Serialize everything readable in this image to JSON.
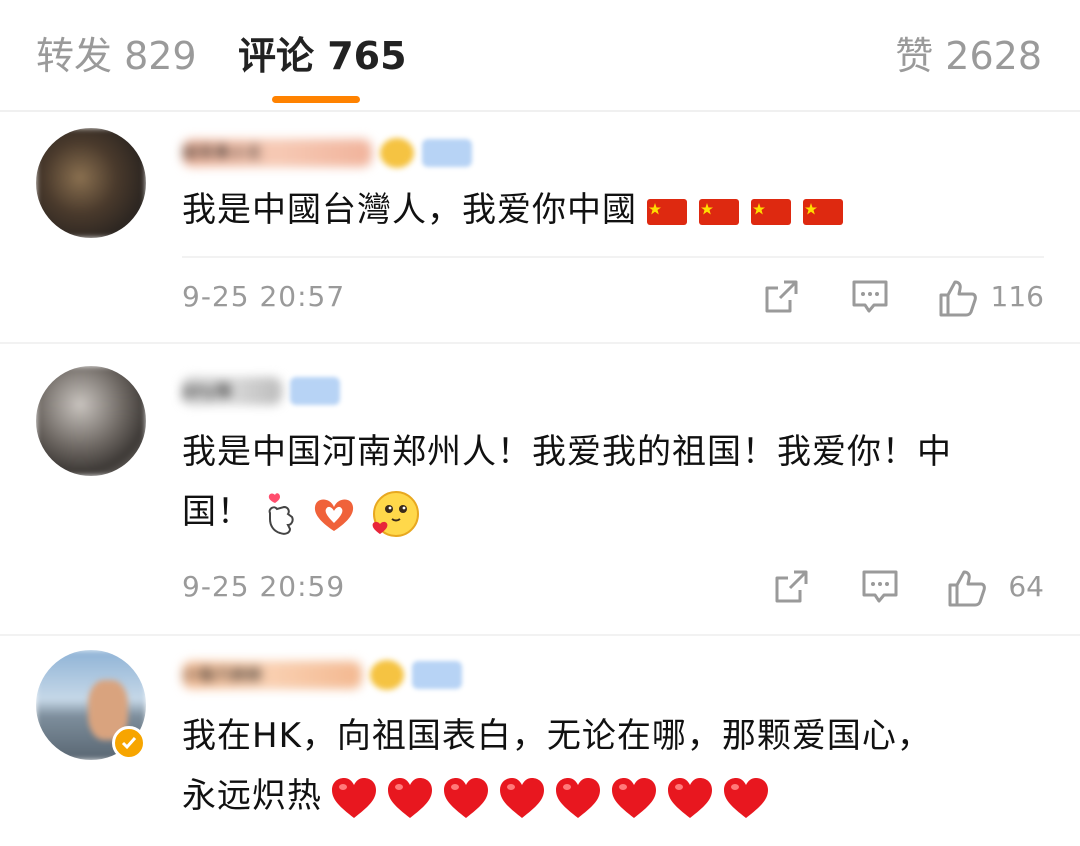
{
  "tabs": {
    "reposts_label": "转发 829",
    "comments_label": "评论 765",
    "likes_label": "赞 2628"
  },
  "comments": [
    {
      "username": "缇菲黄小文",
      "text": "我是中國台灣人，我爱你中國",
      "emoji": [
        "flag-cn-icon",
        "flag-cn-icon",
        "flag-cn-icon",
        "flag-cn-icon"
      ],
      "time": "9-25 20:57",
      "likes": "116"
    },
    {
      "username": "jony猫",
      "text_line1": "我是中国河南郑州人！我爱我的祖国！我爱你！中",
      "text_line2": "国！",
      "emoji": [
        "finger-heart-icon",
        "heart-hands-icon",
        "smiley-heart-icon"
      ],
      "time": "9-25 20:59",
      "likes": "64"
    },
    {
      "username": "小猫爪赫赫",
      "text_line1": "我在HK，向祖国表白，无论在哪，那颗爱国心，",
      "text_line2": "永远炽热",
      "emoji": [
        "red-heart-icon",
        "red-heart-icon",
        "red-heart-icon",
        "red-heart-icon",
        "red-heart-icon",
        "red-heart-icon",
        "red-heart-icon",
        "red-heart-icon"
      ]
    }
  ],
  "colors": {
    "accent": "#ff8200",
    "meta_text": "#9a9a9a",
    "verified": "#f7a500"
  }
}
